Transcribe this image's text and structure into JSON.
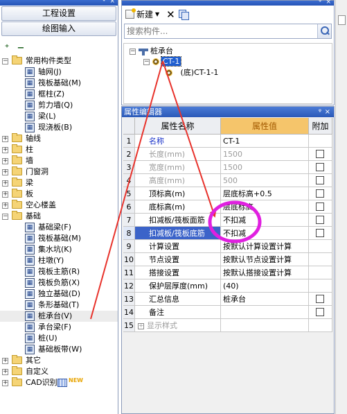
{
  "left_panel": {
    "title_pin": "ᵠ",
    "title_close": "×",
    "project_settings_button": "工程设置",
    "drawing_input_button": "绘图输入",
    "tree": [
      {
        "label": "常用构件类型",
        "level": 0,
        "expanded": true,
        "folder": true
      },
      {
        "label": "轴网(J)",
        "level": 1,
        "icon": "axis-grid-icon"
      },
      {
        "label": "筏板基础(M)",
        "level": 1,
        "icon": "raft-foundation-icon"
      },
      {
        "label": "框柱(Z)",
        "level": 1,
        "icon": "frame-column-icon"
      },
      {
        "label": "剪力墙(Q)",
        "level": 1,
        "icon": "shear-wall-icon"
      },
      {
        "label": "梁(L)",
        "level": 1,
        "icon": "beam-icon"
      },
      {
        "label": "现浇板(B)",
        "level": 1,
        "icon": "cast-slab-icon"
      },
      {
        "label": "轴线",
        "level": 0,
        "expanded": false,
        "folder": true
      },
      {
        "label": "柱",
        "level": 0,
        "expanded": false,
        "folder": true
      },
      {
        "label": "墙",
        "level": 0,
        "expanded": false,
        "folder": true
      },
      {
        "label": "门窗洞",
        "level": 0,
        "expanded": false,
        "folder": true
      },
      {
        "label": "梁",
        "level": 0,
        "expanded": false,
        "folder": true
      },
      {
        "label": "板",
        "level": 0,
        "expanded": false,
        "folder": true
      },
      {
        "label": "空心楼盖",
        "level": 0,
        "expanded": false,
        "folder": true
      },
      {
        "label": "基础",
        "level": 0,
        "expanded": true,
        "folder": true
      },
      {
        "label": "基础梁(F)",
        "level": 1,
        "icon": "foundation-beam-icon"
      },
      {
        "label": "筏板基础(M)",
        "level": 1,
        "icon": "raft-foundation-icon"
      },
      {
        "label": "集水坑(K)",
        "level": 1,
        "icon": "sump-pit-icon"
      },
      {
        "label": "柱墩(Y)",
        "level": 1,
        "icon": "column-pier-icon"
      },
      {
        "label": "筏板主筋(R)",
        "level": 1,
        "icon": "raft-main-rebar-icon"
      },
      {
        "label": "筏板负筋(X)",
        "level": 1,
        "icon": "raft-neg-rebar-icon"
      },
      {
        "label": "独立基础(D)",
        "level": 1,
        "icon": "isolated-footing-icon"
      },
      {
        "label": "条形基础(T)",
        "level": 1,
        "icon": "strip-footing-icon"
      },
      {
        "label": "桩承台(V)",
        "level": 1,
        "icon": "pile-cap-icon",
        "selected": true
      },
      {
        "label": "承台梁(F)",
        "level": 1,
        "icon": "cap-beam-icon"
      },
      {
        "label": "桩(U)",
        "level": 1,
        "icon": "pile-icon"
      },
      {
        "label": "基础板带(W)",
        "level": 1,
        "icon": "foundation-strip-icon"
      },
      {
        "label": "其它",
        "level": 0,
        "expanded": false,
        "folder": true
      },
      {
        "label": "自定义",
        "level": 0,
        "expanded": false,
        "folder": true
      },
      {
        "label": "CAD识别",
        "level": 0,
        "expanded": false,
        "folder": true,
        "badge": "NEW"
      }
    ]
  },
  "component_list": {
    "new_button": "新建",
    "search_placeholder": "搜索构件...",
    "tree": {
      "root": "桩承台",
      "child": "CT-1",
      "grandchild": "(底)CT-1-1"
    }
  },
  "property_editor": {
    "title": "属性编辑器",
    "headers": {
      "name": "属性名称",
      "value": "属性值",
      "add": "附加"
    },
    "rows": [
      {
        "num": "1",
        "name": "名称",
        "value": "CT-1",
        "style": "blue",
        "checkbox": false
      },
      {
        "num": "2",
        "name": "长度(mm)",
        "value": "1500",
        "style": "grey",
        "checkbox": true
      },
      {
        "num": "3",
        "name": "宽度(mm)",
        "value": "1500",
        "style": "grey",
        "checkbox": true
      },
      {
        "num": "4",
        "name": "高度(mm)",
        "value": "500",
        "style": "grey",
        "checkbox": true
      },
      {
        "num": "5",
        "name": "顶标高(m)",
        "value": "层底标高+0.5",
        "style": "normal",
        "checkbox": true
      },
      {
        "num": "6",
        "name": "底标高(m)",
        "value": "层底标高",
        "style": "normal",
        "checkbox": true
      },
      {
        "num": "7",
        "name": "扣减板/筏板面筋",
        "value": "不扣减",
        "style": "normal",
        "checkbox": true
      },
      {
        "num": "8",
        "name": "扣减板/筏板底筋",
        "value": "不扣减",
        "style": "selected",
        "checkbox": true
      },
      {
        "num": "9",
        "name": "计算设置",
        "value": "按默认计算设置计算",
        "style": "normal",
        "checkbox": false
      },
      {
        "num": "10",
        "name": "节点设置",
        "value": "按默认节点设置计算",
        "style": "normal",
        "checkbox": false
      },
      {
        "num": "11",
        "name": "搭接设置",
        "value": "按默认搭接设置计算",
        "style": "normal",
        "checkbox": false
      },
      {
        "num": "12",
        "name": "保护层厚度(mm)",
        "value": "(40)",
        "style": "normal",
        "checkbox": false
      },
      {
        "num": "13",
        "name": "汇总信息",
        "value": "桩承台",
        "style": "normal",
        "checkbox": true
      },
      {
        "num": "14",
        "name": "备注",
        "value": "",
        "style": "normal",
        "checkbox": true
      },
      {
        "num": "15",
        "name": "显示样式",
        "value": "",
        "style": "expand",
        "checkbox": false
      }
    ]
  },
  "colors": {
    "annotation_red": "#e8322b",
    "annotation_magenta": "#e020e0",
    "selection_blue": "#3b63c9",
    "header_value_bg": "#f5c56b"
  }
}
